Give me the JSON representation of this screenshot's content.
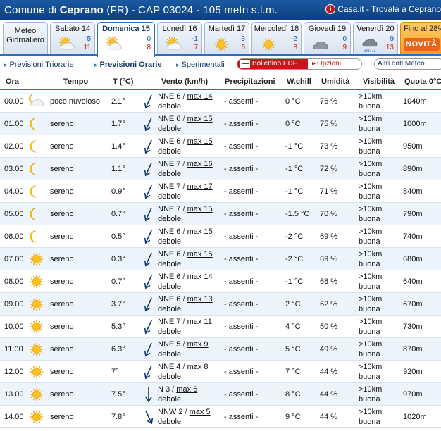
{
  "header": {
    "title_prefix": "Comune di ",
    "title_city": "Ceprano",
    "title_suffix": " (FR)  -  CAP 03024  -  105 metri s.l.m.",
    "casa_icon": "i",
    "casa_link": "Casa.it - Trovala a Ceprano"
  },
  "tabs": [
    {
      "name": "Meteo Giornaliero",
      "icon": "none",
      "min": "",
      "max": ""
    },
    {
      "name": "Sabato 14",
      "icon": "partly-cloudy-icon",
      "min": "5",
      "max": "11"
    },
    {
      "name": "Domenica 15",
      "icon": "partly-cloudy-icon",
      "min": "0",
      "max": "8"
    },
    {
      "name": "Lunedì 16",
      "icon": "partly-cloudy-icon",
      "min": "-1",
      "max": "7"
    },
    {
      "name": "Martedì 17",
      "icon": "sun-icon",
      "min": "-3",
      "max": "6"
    },
    {
      "name": "Mercoledì 18",
      "icon": "sun-icon",
      "min": "-2",
      "max": "8"
    },
    {
      "name": "Giovedì 19",
      "icon": "cloud-icon",
      "min": "0",
      "max": "9"
    },
    {
      "name": "Venerdì 20",
      "icon": "rain-icon",
      "min": "9",
      "max": "13"
    },
    {
      "name": "Fino al 28%",
      "badge": "NOVITÀ",
      "icon": "none",
      "min": "",
      "max": ""
    }
  ],
  "subnav": {
    "triorarie": "Previsioni Triorarie",
    "orarie": "Previsioni Orarie",
    "sperimentali": "Sperimentali",
    "pdf_badge": "—",
    "pdf": "Bollettino PDF",
    "opzioni": "Opzioni",
    "altri": "Altri dati Meteo"
  },
  "columns": {
    "ora": "Ora",
    "tempo": "Tempo",
    "temp": "T (°C)",
    "vento": "Vento (km/h)",
    "prec": "Precipitazioni",
    "chill": "W.chill",
    "umid": "Umidità",
    "vis": "Visibilità",
    "quota": "Quota 0°C"
  },
  "rows": [
    {
      "ora": "00.00",
      "icon": "moon-cloud-icon",
      "tempo": "poco nuvoloso",
      "temp": "2.1°",
      "wind": "NNE 6",
      "max": "max 14",
      "forza": "debole",
      "prec": "- assenti -",
      "chill": "0 °C",
      "umid": "76 %",
      "vis1": ">10km",
      "vis2": "buona",
      "quota": "1040m"
    },
    {
      "ora": "01.00",
      "icon": "moon-icon",
      "tempo": "sereno",
      "temp": "1.7°",
      "wind": "NNE 6",
      "max": "max 15",
      "forza": "debole",
      "prec": "- assenti -",
      "chill": "0 °C",
      "umid": "75 %",
      "vis1": ">10km",
      "vis2": "buona",
      "quota": "1000m"
    },
    {
      "ora": "02.00",
      "icon": "moon-icon",
      "tempo": "sereno",
      "temp": "1.4°",
      "wind": "NNE 6",
      "max": "max 15",
      "forza": "debole",
      "prec": "- assenti -",
      "chill": "-1 °C",
      "umid": "73 %",
      "vis1": ">10km",
      "vis2": "buona",
      "quota": "950m"
    },
    {
      "ora": "03.00",
      "icon": "moon-icon",
      "tempo": "sereno",
      "temp": "1.1°",
      "wind": "NNE 7",
      "max": "max 16",
      "forza": "debole",
      "prec": "- assenti -",
      "chill": "-1 °C",
      "umid": "72 %",
      "vis1": ">10km",
      "vis2": "buona",
      "quota": "890m"
    },
    {
      "ora": "04.00",
      "icon": "moon-icon",
      "tempo": "sereno",
      "temp": "0.9°",
      "wind": "NNE 7",
      "max": "max 17",
      "forza": "debole",
      "prec": "- assenti -",
      "chill": "-1 °C",
      "umid": "71 %",
      "vis1": ">10km",
      "vis2": "buona",
      "quota": "840m"
    },
    {
      "ora": "05.00",
      "icon": "moon-icon",
      "tempo": "sereno",
      "temp": "0.7°",
      "wind": "NNE 7",
      "max": "max 15",
      "forza": "debole",
      "prec": "- assenti -",
      "chill": "-1.5 °C",
      "umid": "70 %",
      "vis1": ">10km",
      "vis2": "buona",
      "quota": "790m"
    },
    {
      "ora": "06.00",
      "icon": "moon-icon",
      "tempo": "sereno",
      "temp": "0.5°",
      "wind": "NNE 6",
      "max": "max 15",
      "forza": "debole",
      "prec": "- assenti -",
      "chill": "-2 °C",
      "umid": "69 %",
      "vis1": ">10km",
      "vis2": "buona",
      "quota": "740m"
    },
    {
      "ora": "07.00",
      "icon": "sun-icon",
      "tempo": "sereno",
      "temp": "0.3°",
      "wind": "NNE 6",
      "max": "max 15",
      "forza": "debole",
      "prec": "- assenti -",
      "chill": "-2 °C",
      "umid": "69 %",
      "vis1": ">10km",
      "vis2": "buona",
      "quota": "680m"
    },
    {
      "ora": "08.00",
      "icon": "sun-icon",
      "tempo": "sereno",
      "temp": "0.7°",
      "wind": "NNE 6",
      "max": "max 14",
      "forza": "debole",
      "prec": "- assenti -",
      "chill": "-1 °C",
      "umid": "68 %",
      "vis1": ">10km",
      "vis2": "buona",
      "quota": "640m"
    },
    {
      "ora": "09.00",
      "icon": "sun-icon",
      "tempo": "sereno",
      "temp": "3.7°",
      "wind": "NNE 6",
      "max": "max 13",
      "forza": "debole",
      "prec": "- assenti -",
      "chill": "2 °C",
      "umid": "62 %",
      "vis1": ">10km",
      "vis2": "buona",
      "quota": "670m"
    },
    {
      "ora": "10.00",
      "icon": "sun-icon",
      "tempo": "sereno",
      "temp": "5.3°",
      "wind": "NNE 7",
      "max": "max 11",
      "forza": "debole",
      "prec": "- assenti -",
      "chill": "4 °C",
      "umid": "50 %",
      "vis1": ">10km",
      "vis2": "buona",
      "quota": "730m"
    },
    {
      "ora": "11.00",
      "icon": "sun-icon",
      "tempo": "sereno",
      "temp": "6.3°",
      "wind": "NNE 5",
      "max": "max 9",
      "forza": "debole",
      "prec": "- assenti -",
      "chill": "5 °C",
      "umid": "49 %",
      "vis1": ">10km",
      "vis2": "buona",
      "quota": "870m"
    },
    {
      "ora": "12.00",
      "icon": "sun-icon",
      "tempo": "sereno",
      "temp": "7°",
      "wind": "NNE 4",
      "max": "max 8",
      "forza": "debole",
      "prec": "- assenti -",
      "chill": "7 °C",
      "umid": "44 %",
      "vis1": ">10km",
      "vis2": "buona",
      "quota": "920m"
    },
    {
      "ora": "13.00",
      "icon": "sun-icon",
      "tempo": "sereno",
      "temp": "7.5°",
      "wind": "N 3",
      "max": "max 6",
      "forza": "debole",
      "prec": "- assenti -",
      "chill": "8 °C",
      "umid": "44 %",
      "vis1": ">10km",
      "vis2": "buona",
      "quota": "970m"
    },
    {
      "ora": "14.00",
      "icon": "sun-icon",
      "tempo": "sereno",
      "temp": "7.8°",
      "wind": "NNW 2",
      "max": "max 5",
      "forza": "debole",
      "prec": "- assenti -",
      "chill": "9 °C",
      "umid": "44 %",
      "vis1": ">10km",
      "vis2": "buona",
      "quota": "1020m"
    }
  ]
}
